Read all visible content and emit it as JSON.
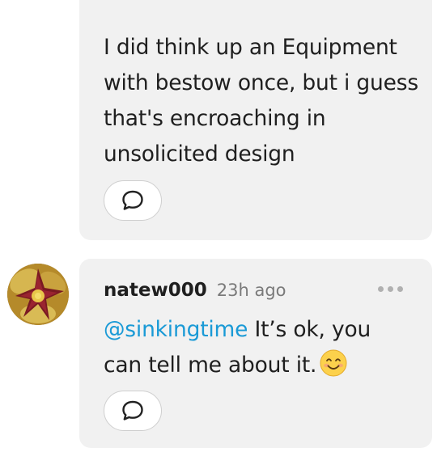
{
  "comments": [
    {
      "text": "I did think up an Equipment with bestow once, but i guess that's encroaching in unsolicited design",
      "reply_icon": "chat-bubble-icon"
    },
    {
      "username": "natew000",
      "timestamp": "23h ago",
      "mention": "@sinkingtime",
      "text": " It’s ok, you can tell me about it.",
      "emoji": "smiling-face-emoji",
      "more_icon": "more-horizontal-icon",
      "reply_icon": "chat-bubble-icon",
      "avatar_icon": "flower-photo-avatar"
    }
  ],
  "colors": {
    "bubble": "#f1f1f1",
    "mention": "#1a9ad6",
    "muted": "#7a7a7a"
  }
}
